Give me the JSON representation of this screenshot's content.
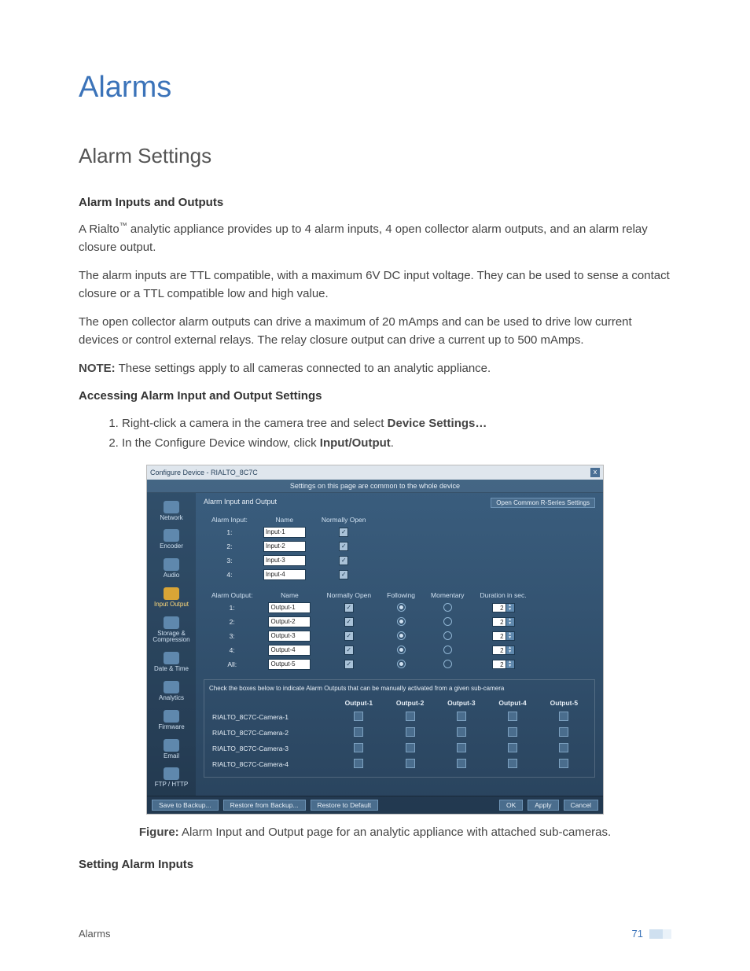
{
  "page": {
    "title": "Alarms",
    "section": "Alarm Settings",
    "subhead1": "Alarm Inputs and Outputs",
    "p1_a": "A Rialto",
    "tm": "™",
    "p1_b": " analytic appliance provides up to 4 alarm inputs, 4 open collector alarm outputs, and an alarm relay closure output.",
    "p2": "The alarm inputs are TTL compatible, with a maximum 6V DC input voltage. They can be used to sense a contact closure or a TTL compatible low and high value.",
    "p3": "The open collector alarm outputs can drive a maximum of 20 mAmps and can be used to drive low current devices or control external relays. The relay closure output can drive a current up to 500 mAmps.",
    "note_label": "NOTE:",
    "note_body": " These settings apply to all cameras connected to an analytic appliance.",
    "subhead2": "Accessing Alarm Input and Output Settings",
    "step1_a": "Right-click a camera in the camera tree and select ",
    "step1_b": "Device Settings…",
    "step2_a": "In the Configure Device window, click ",
    "step2_b": "Input/Output",
    "step2_c": ".",
    "caption_label": "Figure:",
    "caption_body": " Alarm Input and Output page for an analytic appliance with attached sub-cameras.",
    "subhead3": "Setting Alarm Inputs",
    "footer_left": "Alarms",
    "footer_page": "71"
  },
  "screenshot": {
    "window_title": "Configure Device - RIALTO_8C7C",
    "close": "x",
    "banner": "Settings on this page are common to the whole device",
    "nav": [
      {
        "label": "Network"
      },
      {
        "label": "Encoder"
      },
      {
        "label": "Audio"
      },
      {
        "label": "Input Output",
        "active": true
      },
      {
        "label": "Storage\n& Compression"
      },
      {
        "label": "Date & Time"
      },
      {
        "label": "Analytics"
      },
      {
        "label": "Firmware"
      },
      {
        "label": "Email"
      },
      {
        "label": "FTP / HTTP"
      }
    ],
    "main_title": "Alarm Input and Output",
    "open_common_btn": "Open Common R-Series Settings",
    "inputs": {
      "headers": [
        "Alarm Input:",
        "Name",
        "Normally Open"
      ],
      "rows": [
        {
          "idx": "1:",
          "name": "Input-1",
          "open": true
        },
        {
          "idx": "2:",
          "name": "Input-2",
          "open": true
        },
        {
          "idx": "3:",
          "name": "Input-3",
          "open": true
        },
        {
          "idx": "4:",
          "name": "Input-4",
          "open": true
        }
      ]
    },
    "outputs": {
      "headers": [
        "Alarm Output:",
        "Name",
        "Normally Open",
        "Following",
        "Momentary",
        "Duration in sec."
      ],
      "rows": [
        {
          "idx": "1:",
          "name": "Output-1",
          "open": true,
          "following": true,
          "momentary": false,
          "dur": "2"
        },
        {
          "idx": "2:",
          "name": "Output-2",
          "open": true,
          "following": true,
          "momentary": false,
          "dur": "2"
        },
        {
          "idx": "3:",
          "name": "Output-3",
          "open": true,
          "following": true,
          "momentary": false,
          "dur": "2"
        },
        {
          "idx": "4:",
          "name": "Output-4",
          "open": true,
          "following": true,
          "momentary": false,
          "dur": "2"
        },
        {
          "idx": "All:",
          "name": "Output-5",
          "open": true,
          "following": true,
          "momentary": false,
          "dur": "2"
        }
      ]
    },
    "matrix": {
      "note": "Check the boxes below to indicate Alarm Outputs that can be manually activated from a given sub-camera",
      "cols": [
        "Output-1",
        "Output-2",
        "Output-3",
        "Output-4",
        "Output-5"
      ],
      "rows": [
        "RIALTO_8C7C-Camera-1",
        "RIALTO_8C7C-Camera-2",
        "RIALTO_8C7C-Camera-3",
        "RIALTO_8C7C-Camera-4"
      ]
    },
    "footer_buttons_left": [
      "Save to Backup...",
      "Restore from Backup...",
      "Restore to Default"
    ],
    "footer_buttons_right": [
      "OK",
      "Apply",
      "Cancel"
    ]
  }
}
